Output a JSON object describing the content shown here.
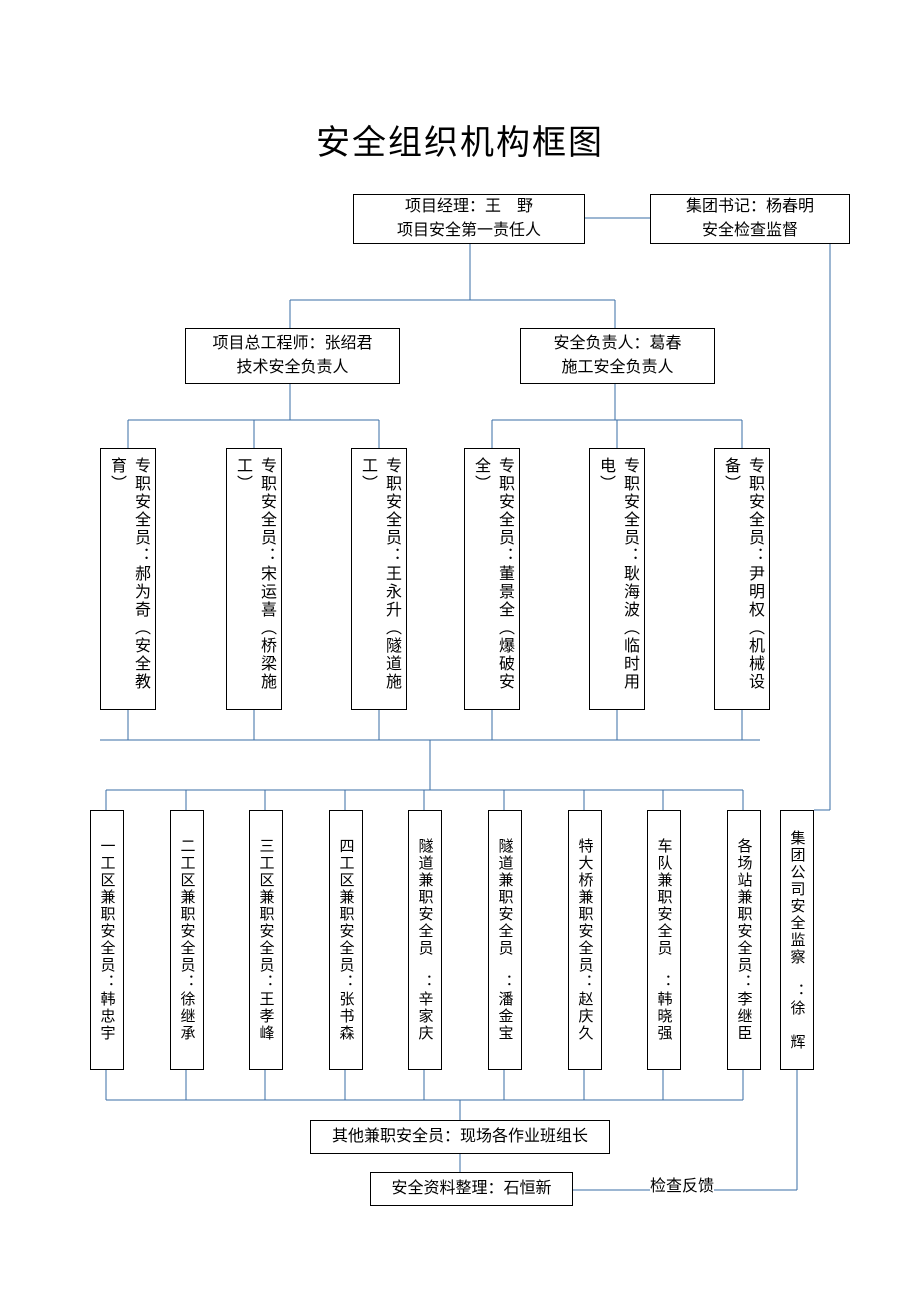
{
  "title": "安全组织机构框图",
  "top": {
    "pm_line1": "项目经理：王　野",
    "pm_line2": "项目安全第一责任人",
    "group_line1": "集团书记：杨春明",
    "group_line2": "安全检查监督"
  },
  "level2": {
    "chief_line1": "项目总工程师：张绍君",
    "chief_line2": "技术安全负责人",
    "safety_line1": "安全负责人：葛春",
    "safety_line2": "施工安全负责人"
  },
  "level3": [
    "专职安全员：郝为奇（安全教育）",
    "专职安全员：宋运喜（桥梁施工）",
    "专职安全员：王永升（隧道施工）",
    "专职安全员：董景全（爆破安全）",
    "专职安全员：耿海波（临时用电）",
    "专职安全员：尹明权（机械设备）"
  ],
  "level4": [
    "一工区兼职安全员：韩忠宇",
    "二工区兼职安全员：徐继承",
    "三工区兼职安全员：王孝峰",
    "四工区兼职安全员：张书森",
    "隧道兼职安全员　：辛家庆",
    "隧道兼职安全员　：潘金宝",
    "特大桥兼职安全员：赵庆久",
    "车队兼职安全员　：韩晓强",
    "各场站兼职安全员：李继臣",
    "集团公司安全监察　：徐　辉"
  ],
  "bottom": {
    "other": "其他兼职安全员：现场各作业班组长",
    "data": "安全资料整理：石恒新",
    "feedback": "检查反馈"
  }
}
